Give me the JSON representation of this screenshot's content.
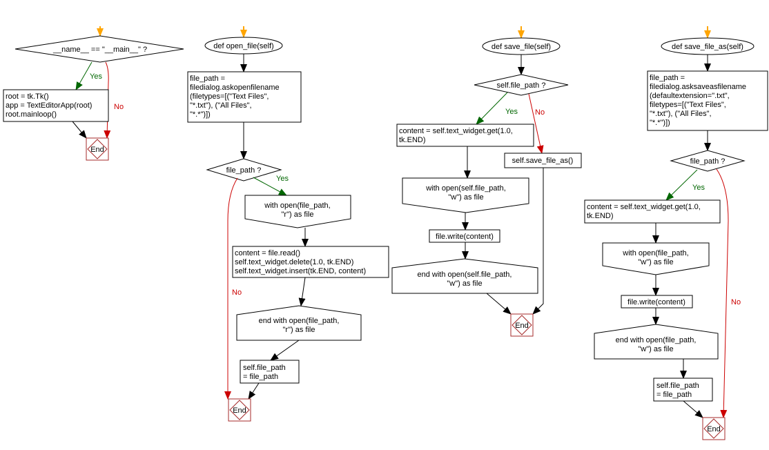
{
  "colors": {
    "yes": "#006600",
    "no": "#cc0000",
    "start": "#ffa500",
    "end_border": "#a52a2a"
  },
  "labels": {
    "yes": "Yes",
    "no": "No",
    "end": "End"
  },
  "main": {
    "decision": "__name__ == \"__main__\" ?",
    "body": [
      "root = tk.Tk()",
      "app = TextEditorApp(root)",
      "root.mainloop()"
    ]
  },
  "open_file": {
    "title": "def open_file(self)",
    "assign": [
      "file_path =",
      "filedialog.askopenfilename",
      "(filetypes=[(\"Text Files\",",
      "\"*.txt\"), (\"All Files\",",
      "\"*.*\")])"
    ],
    "decision": "file_path ?",
    "with": [
      "with open(file_path,",
      "\"r\") as file"
    ],
    "body": [
      "content = file.read()",
      "self.text_widget.delete(1.0, tk.END)",
      "self.text_widget.insert(tk.END, content)"
    ],
    "end_with": [
      "end with open(file_path,",
      "\"r\") as file"
    ],
    "set": [
      "self.file_path",
      "= file_path"
    ]
  },
  "save_file": {
    "title": "def save_file(self)",
    "decision": "self.file_path ?",
    "content": [
      "content = self.text_widget.get(1.0,",
      "tk.END)"
    ],
    "no_call": "self.save_file_as()",
    "with": [
      "with open(self.file_path,",
      "\"w\") as file"
    ],
    "write": "file.write(content)",
    "end_with": [
      "end with open(self.file_path,",
      "\"w\") as file"
    ]
  },
  "save_file_as": {
    "title": "def save_file_as(self)",
    "assign": [
      "file_path =",
      "filedialog.asksaveasfilename",
      "(defaultextension=\".txt\",",
      "filetypes=[(\"Text Files\",",
      "\"*.txt\"), (\"All Files\",",
      "\"*.*\")])"
    ],
    "decision": "file_path ?",
    "content": [
      "content = self.text_widget.get(1.0,",
      "tk.END)"
    ],
    "with": [
      "with open(file_path,",
      "\"w\") as file"
    ],
    "write": "file.write(content)",
    "end_with": [
      "end with open(file_path,",
      "\"w\") as file"
    ],
    "set": [
      "self.file_path",
      "= file_path"
    ]
  }
}
